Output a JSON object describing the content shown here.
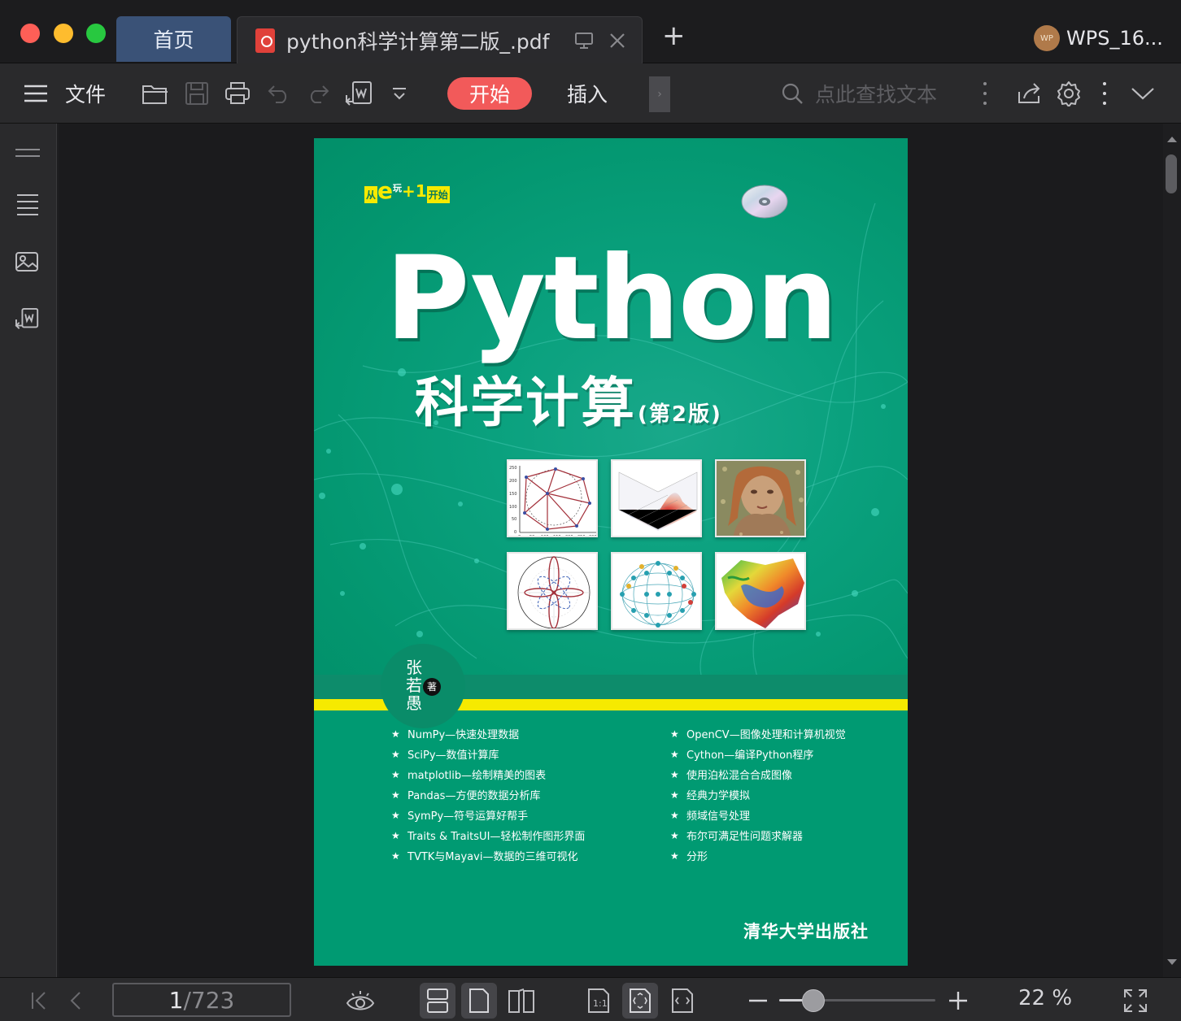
{
  "window": {
    "tabs": [
      {
        "label": "首页",
        "active": false
      },
      {
        "label": "python科学计算第二版_.pdf",
        "active": true
      }
    ],
    "new_tab_label": "+",
    "account_name": "WPS_16...",
    "account_avatar_text": "WP"
  },
  "toolbar": {
    "file_menu_label": "文件",
    "start_tab_label": "开始",
    "insert_tab_label": "插入",
    "more_tabs_glyph": "›",
    "search_placeholder": "点此查找文本",
    "start_tab_color": "#f25a5a"
  },
  "document": {
    "badge": {
      "prefix": "从",
      "e": "e",
      "play": "玩",
      "plus": "+1",
      "suffix": "开始"
    },
    "title_en": "Python",
    "title_cn": "科学计算",
    "edition": "(第2版)",
    "author": "张若愚",
    "author_suffix": "著",
    "features_left": [
      "NumPy—快速处理数据",
      "SciPy—数值计算库",
      "matplotlib—绘制精美的图表",
      "Pandas—方便的数据分析库",
      "SymPy—符号运算好帮手",
      "Traits & TraitsUI—轻松制作图形界面",
      "TVTK与Mayavi—数据的三维可视化"
    ],
    "features_right": [
      "OpenCV—图像处理和计算机视觉",
      "Cython—编译Python程序",
      "使用泊松混合合成图像",
      "经典力学模拟",
      "频域信号处理",
      "布尔可满足性问题求解器",
      "分形"
    ],
    "publisher": "清华大学出版社",
    "cover_color": "#009a72",
    "band_color": "#f6ea00",
    "thumb1_yticks": [
      "250",
      "200",
      "150",
      "100",
      "50",
      "0"
    ],
    "thumb1_xticks": [
      "0",
      "50",
      "100",
      "150",
      "200",
      "250",
      "300"
    ]
  },
  "statusbar": {
    "current_page": "1",
    "separator": "/",
    "total_pages": "723",
    "zoom_percent": "22 %",
    "zoom_level": 0.22
  }
}
